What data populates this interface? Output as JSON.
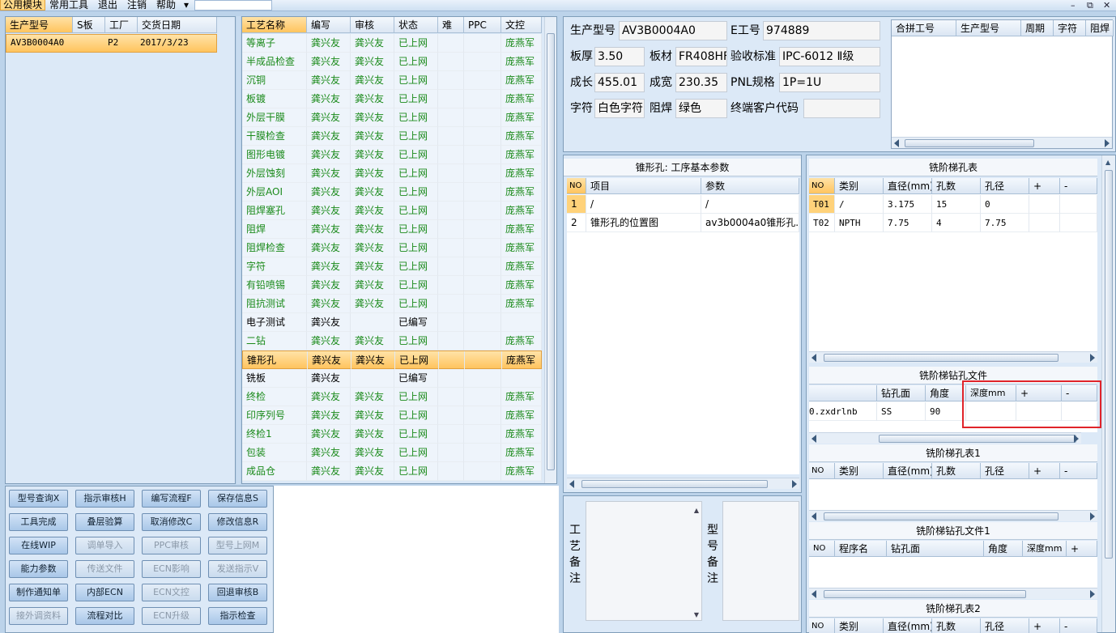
{
  "menu": {
    "items": [
      "公用模块",
      "常用工具",
      "退出",
      "注销",
      "帮助"
    ],
    "help_arrow": "▾",
    "win_controls": [
      "–",
      "⧉",
      "✕"
    ]
  },
  "left_list": {
    "columns": [
      "生产型号",
      "S板",
      "工厂",
      "交货日期"
    ],
    "rows": [
      [
        "AV3B0004A0",
        "",
        "P2",
        "2017/3/23"
      ]
    ]
  },
  "process_grid": {
    "columns": [
      "工艺名称",
      "编写",
      "审核",
      "状态",
      "难",
      "PPC",
      "文控"
    ],
    "rows": [
      [
        "等离子",
        "龚兴友",
        "龚兴友",
        "已上网",
        "",
        "",
        "庞燕军"
      ],
      [
        "半成品检查",
        "龚兴友",
        "龚兴友",
        "已上网",
        "",
        "",
        "庞燕军"
      ],
      [
        "沉铜",
        "龚兴友",
        "龚兴友",
        "已上网",
        "",
        "",
        "庞燕军"
      ],
      [
        "板镀",
        "龚兴友",
        "龚兴友",
        "已上网",
        "",
        "",
        "庞燕军"
      ],
      [
        "外层干膜",
        "龚兴友",
        "龚兴友",
        "已上网",
        "",
        "",
        "庞燕军"
      ],
      [
        "干膜检查",
        "龚兴友",
        "龚兴友",
        "已上网",
        "",
        "",
        "庞燕军"
      ],
      [
        "图形电镀",
        "龚兴友",
        "龚兴友",
        "已上网",
        "",
        "",
        "庞燕军"
      ],
      [
        "外层蚀刻",
        "龚兴友",
        "龚兴友",
        "已上网",
        "",
        "",
        "庞燕军"
      ],
      [
        "外层AOI",
        "龚兴友",
        "龚兴友",
        "已上网",
        "",
        "",
        "庞燕军"
      ],
      [
        "阻焊塞孔",
        "龚兴友",
        "龚兴友",
        "已上网",
        "",
        "",
        "庞燕军"
      ],
      [
        "阻焊",
        "龚兴友",
        "龚兴友",
        "已上网",
        "",
        "",
        "庞燕军"
      ],
      [
        "阻焊检查",
        "龚兴友",
        "龚兴友",
        "已上网",
        "",
        "",
        "庞燕军"
      ],
      [
        "字符",
        "龚兴友",
        "龚兴友",
        "已上网",
        "",
        "",
        "庞燕军"
      ],
      [
        "有铅喷锡",
        "龚兴友",
        "龚兴友",
        "已上网",
        "",
        "",
        "庞燕军"
      ],
      [
        "阻抗测试",
        "龚兴友",
        "龚兴友",
        "已上网",
        "",
        "",
        "庞燕军"
      ],
      [
        "电子测试",
        "龚兴友",
        "",
        "已编写",
        "",
        "",
        ""
      ],
      [
        "二钻",
        "龚兴友",
        "龚兴友",
        "已上网",
        "",
        "",
        "庞燕军"
      ],
      [
        "锥形孔",
        "龚兴友",
        "龚兴友",
        "已上网",
        "",
        "",
        "庞燕军"
      ],
      [
        "铣板",
        "龚兴友",
        "",
        "已编写",
        "",
        "",
        ""
      ],
      [
        "终检",
        "龚兴友",
        "龚兴友",
        "已上网",
        "",
        "",
        "庞燕军"
      ],
      [
        "印序列号",
        "龚兴友",
        "龚兴友",
        "已上网",
        "",
        "",
        "庞燕军"
      ],
      [
        "终检1",
        "龚兴友",
        "龚兴友",
        "已上网",
        "",
        "",
        "庞燕军"
      ],
      [
        "包装",
        "龚兴友",
        "龚兴友",
        "已上网",
        "",
        "",
        "庞燕军"
      ],
      [
        "成品仓",
        "龚兴友",
        "龚兴友",
        "已上网",
        "",
        "",
        "庞燕军"
      ]
    ],
    "selected_index": 17,
    "status_colors": {
      "green": "#1a8a1a",
      "black": "#000000"
    }
  },
  "buttons": [
    [
      "型号查询X",
      "指示审核H",
      "编写流程F",
      "保存信息S"
    ],
    [
      "工具完成",
      "叠层验算",
      "取消修改C",
      "修改信息R"
    ],
    [
      "在线WIP",
      "调单导入",
      "PPC审核",
      "型号上网M"
    ],
    [
      "能力参数",
      "传送文件",
      "ECN影响",
      "发送指示V"
    ],
    [
      "制作通知单",
      "内部ECN",
      "ECN文控",
      "回退审核B"
    ],
    [
      "接外调资料",
      "流程对比",
      "ECN升级",
      "指示检查"
    ]
  ],
  "disabled_buttons": [
    "调单导入",
    "PPC审核",
    "型号上网M",
    "传送文件",
    "ECN影响",
    "发送指示V",
    "ECN文控",
    "接外调资料",
    "ECN升级"
  ],
  "info": {
    "model_label": "生产型号",
    "model": "AV3B0004A0",
    "eno_label": "E工号",
    "eno": "974889",
    "thickness_label": "板厚",
    "thickness": "3.50",
    "material_label": "板材",
    "material": "FR408HF",
    "standard_label": "验收标准",
    "standard": "IPC-6012 Ⅱ级",
    "length_label": "成长",
    "length": "455.01",
    "width_label": "成宽",
    "width": "230.35",
    "pnl_label": "PNL规格",
    "pnl": "1P=1U",
    "char_label": "字符",
    "char": "白色字符",
    "mask_label": "阻焊",
    "mask": "绿色",
    "customer_label": "终端客户代码",
    "customer": ""
  },
  "merge_table": {
    "columns": [
      "合拼工号",
      "生产型号",
      "周期",
      "字符",
      "阻焊"
    ]
  },
  "basic_params": {
    "title": "锥形孔: 工序基本参数",
    "columns": [
      "NO",
      "项目",
      "参数"
    ],
    "rows": [
      [
        "1",
        "/",
        "/"
      ],
      [
        "2",
        "锥形孔的位置图",
        "av3b0004a0锥形孔.pdf"
      ]
    ]
  },
  "milling_table": {
    "title": "铣阶梯孔表",
    "columns": [
      "NO",
      "类别",
      "直径(mm)",
      "孔数",
      "孔径",
      "+",
      "-"
    ],
    "rows": [
      [
        "T01",
        "/",
        "3.175",
        "15",
        "0"
      ],
      [
        "T02",
        "NPTH",
        "7.75",
        "4",
        "7.75"
      ]
    ]
  },
  "milling_drill_file": {
    "title": "铣阶梯钻孔文件",
    "columns": [
      "",
      "钻孔面",
      "角度",
      "深度mm",
      "+",
      "-"
    ],
    "rows": [
      [
        "0.zxdrlnb",
        "SS",
        "90",
        "",
        "",
        ""
      ]
    ]
  },
  "milling_table1": {
    "title": "铣阶梯孔表1",
    "columns": [
      "NO",
      "类别",
      "直径(mm)",
      "孔数",
      "孔径",
      "+",
      "-"
    ]
  },
  "milling_drill_file1": {
    "title": "铣阶梯钻孔文件1",
    "columns": [
      "NO",
      "程序名",
      "钻孔面",
      "角度",
      "深度mm",
      "+"
    ]
  },
  "milling_table2": {
    "title": "铣阶梯孔表2",
    "columns": [
      "NO",
      "类别",
      "直径(mm)",
      "孔数",
      "孔径",
      "+",
      "-"
    ]
  },
  "notes": {
    "process_label": "工艺备注",
    "model_label": "型号备注"
  },
  "highlight_color": "#e0242a"
}
